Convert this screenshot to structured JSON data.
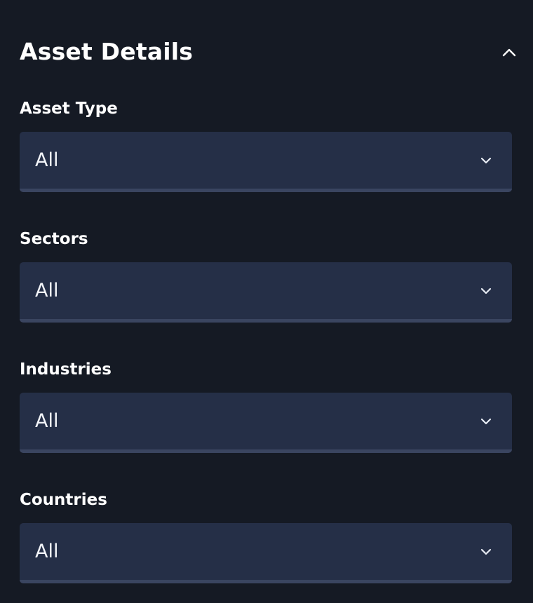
{
  "section": {
    "title": "Asset Details",
    "collapse_icon": "chevron-up-icon"
  },
  "fields": [
    {
      "label": "Asset Type",
      "value": "All",
      "icon": "chevron-down-icon"
    },
    {
      "label": "Sectors",
      "value": "All",
      "icon": "chevron-down-icon"
    },
    {
      "label": "Industries",
      "value": "All",
      "icon": "chevron-down-icon"
    },
    {
      "label": "Countries",
      "value": "All",
      "icon": "chevron-down-icon"
    }
  ],
  "colors": {
    "background": "#151a24",
    "select_background": "#252f47",
    "select_underline": "#3a4560",
    "text": "#ffffff"
  }
}
